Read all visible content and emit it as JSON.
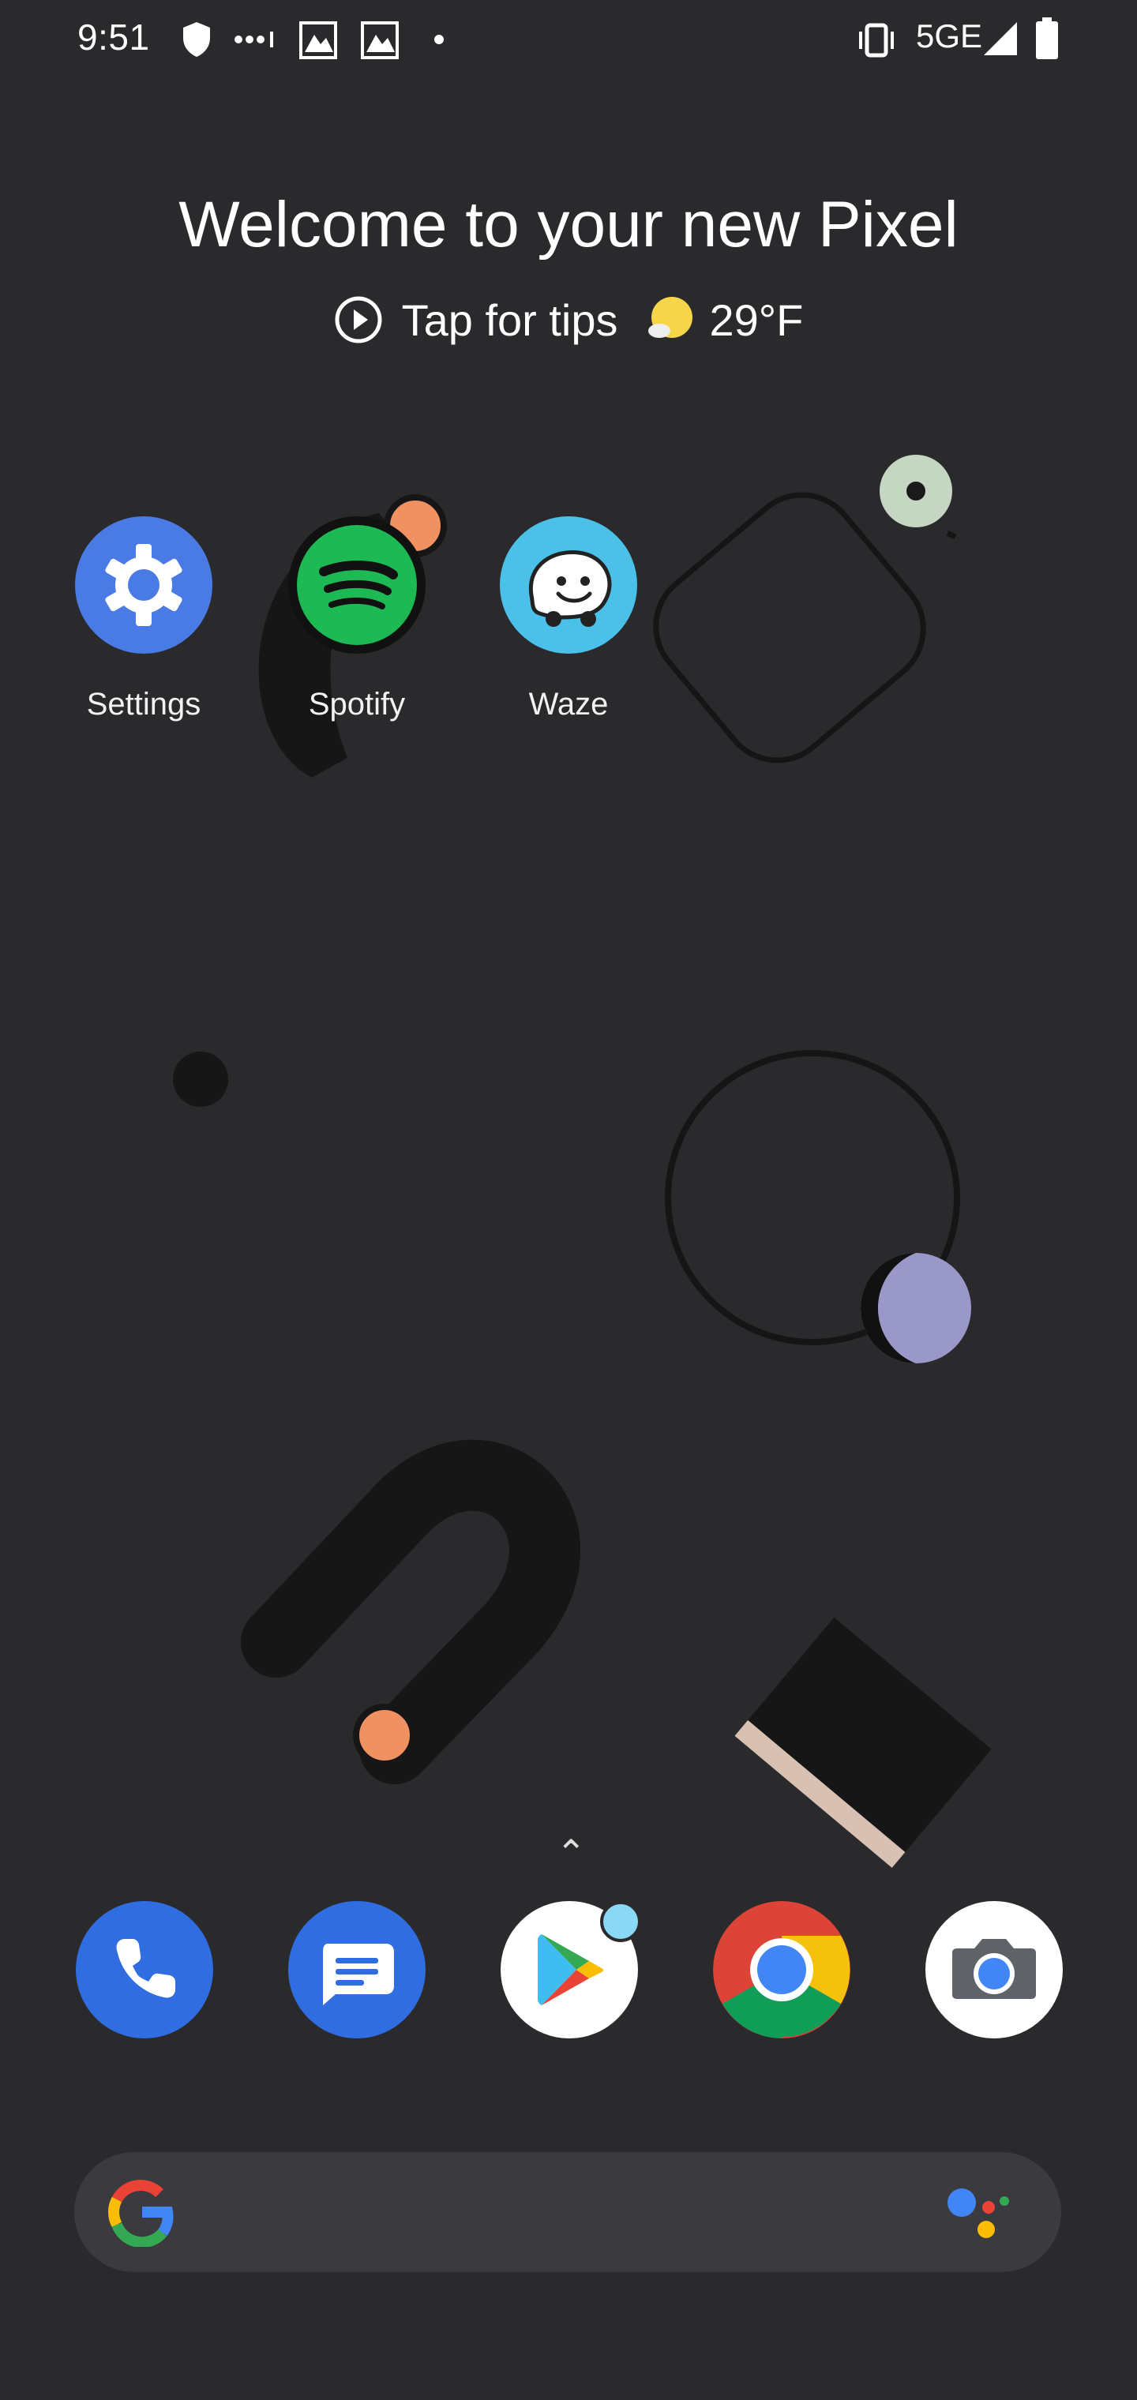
{
  "status_bar": {
    "time": "9:51",
    "network": "5GE",
    "icons": [
      "shield-icon",
      "dots-icon",
      "notification-icon",
      "notification-icon",
      "dot-icon",
      "vibrate-icon",
      "signal-icon",
      "battery-icon"
    ]
  },
  "smartspace": {
    "welcome": "Welcome to your new Pixel",
    "tips": "Tap for tips",
    "temperature": "29°F"
  },
  "home_apps": [
    {
      "label": "Settings",
      "icon": "settings-icon"
    },
    {
      "label": "Spotify",
      "icon": "spotify-icon"
    },
    {
      "label": "Waze",
      "icon": "waze-icon"
    }
  ],
  "dock": [
    {
      "name": "phone",
      "icon": "phone-icon"
    },
    {
      "name": "messages",
      "icon": "messages-icon"
    },
    {
      "name": "play-store",
      "icon": "play-store-icon"
    },
    {
      "name": "chrome",
      "icon": "chrome-icon"
    },
    {
      "name": "camera",
      "icon": "camera-icon"
    }
  ],
  "search": {
    "logo": "google-g-icon",
    "assistant": "assistant-icon"
  },
  "colors": {
    "background": "#2a2a2d",
    "settings_blue": "#4a7be5",
    "spotify_green": "#1db954",
    "waze_blue": "#4bc0e9",
    "dock_blue": "#2f6de1",
    "orange_accent": "#ef9160"
  }
}
